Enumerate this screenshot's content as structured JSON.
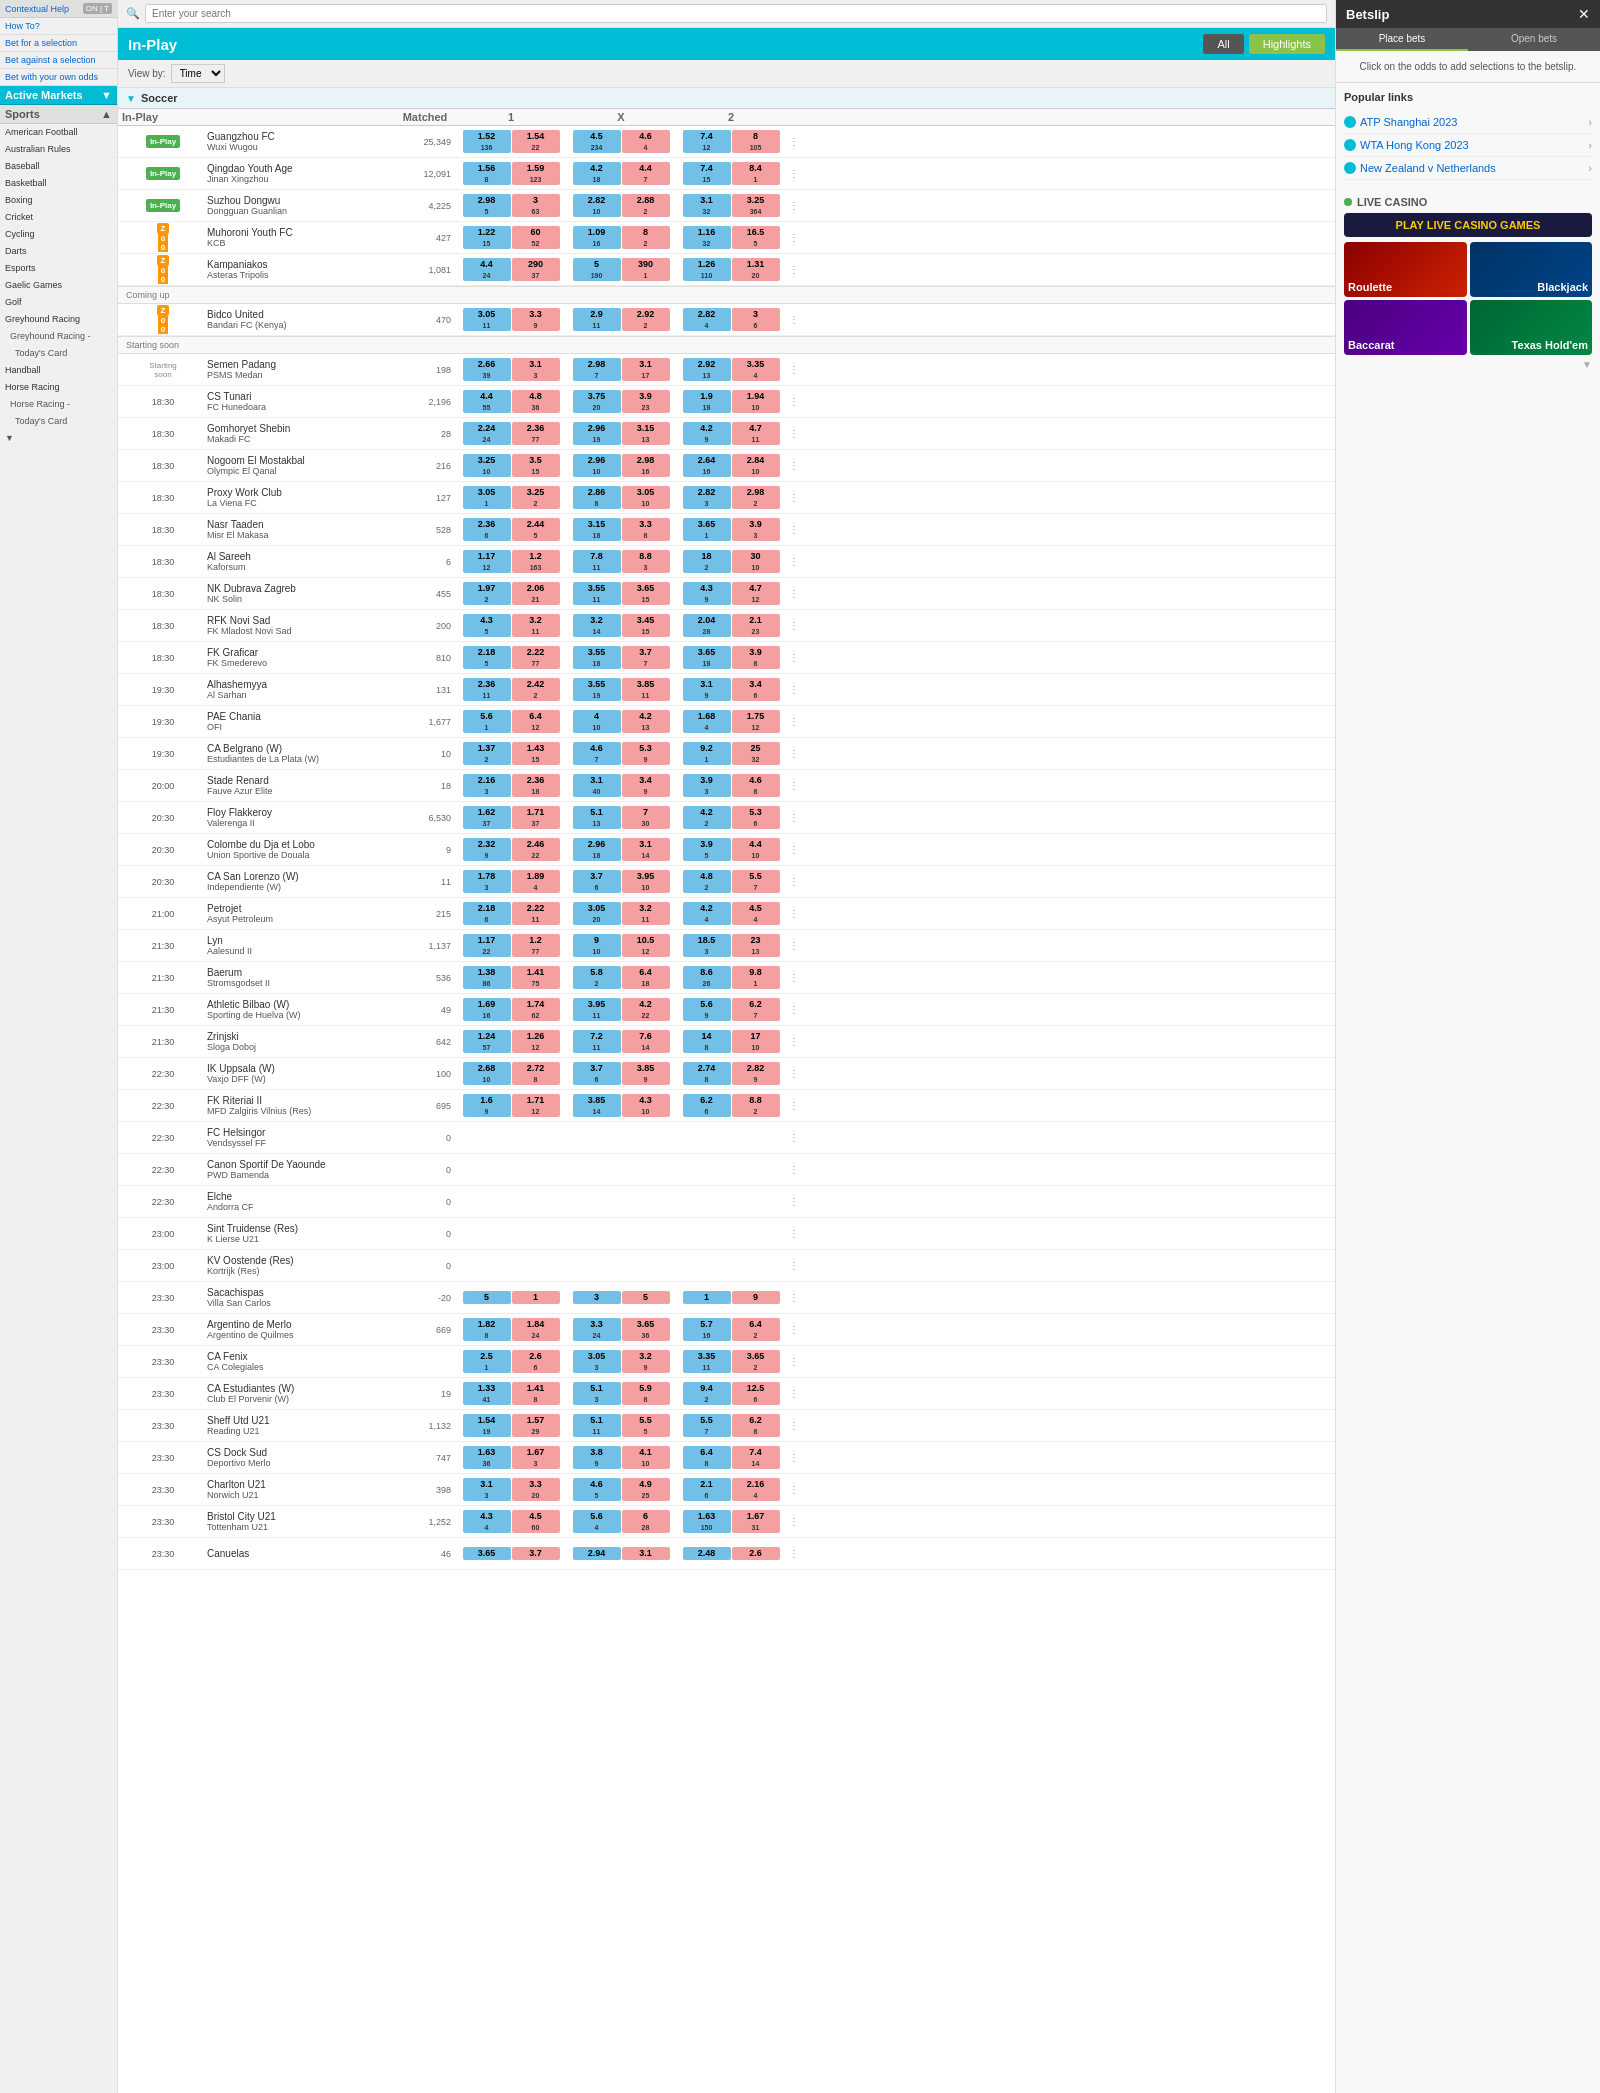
{
  "header": {
    "search_placeholder": "Enter your search",
    "in_play_title": "In-Play",
    "btn_all": "All",
    "btn_highlights": "Highlights",
    "view_by_label": "View by:",
    "view_by_value": "Time"
  },
  "topbar": {
    "contextual_help": "Contextual Help",
    "how_to": "How To?",
    "bet_for_selection": "Bet for a selection",
    "bet_against_selection": "Bet against a selection",
    "bet_own_odds": "Bet with your own odds",
    "active_markets": "Active Markets"
  },
  "sidebar": {
    "sports_label": "Sports",
    "items": [
      "American Football",
      "Australian Rules",
      "Baseball",
      "Basketball",
      "Boxing",
      "Cricket",
      "Cycling",
      "Darts",
      "Esports",
      "Gaelic Games",
      "Golf",
      "Greyhound Racing",
      "Greyhound Racing -",
      "Today's Card",
      "Handball",
      "Horse Racing",
      "Horse Racing -",
      "Today's Card"
    ]
  },
  "betslip": {
    "title": "Betslip",
    "tab_place": "Place bets",
    "tab_open": "Open bets",
    "message": "Click on the odds to add selections to the betslip.",
    "popular_links_title": "Popular links",
    "links": [
      "ATP Shanghai 2023",
      "WTA Hong Kong 2023",
      "New Zealand v Netherlands"
    ],
    "live_casino_label": "LIVE CASINO",
    "casino_banner": "PLAY LIVE CASINO GAMES",
    "games": [
      "Roulette",
      "Blackjack",
      "Baccarat",
      "Texas Hold'em"
    ]
  },
  "section": {
    "soccer_label": "Soccer",
    "col_in_play": "In-Play",
    "col_matched": "Matched",
    "col_1": "1",
    "col_x": "X",
    "col_2": "2"
  },
  "matches": [
    {
      "status": "In-Play",
      "time": "",
      "team1": "Guangzhou FC",
      "team2": "Wuxi Wugou",
      "matched": "25,349",
      "b1": "1.52",
      "b1s": "136",
      "l1": "1.54",
      "l1s": "22",
      "bx": "4.5",
      "bxs": "234",
      "lx": "4.6",
      "lxs": "4",
      "b2": "7.4",
      "b2s": "12",
      "l2": "8",
      "l2s": "105"
    },
    {
      "status": "In-Play",
      "time": "",
      "team1": "Qingdao Youth Age",
      "team2": "Jinan Xingzhou",
      "matched": "12,091",
      "b1": "1.56",
      "b1s": "8",
      "l1": "1.59",
      "l1s": "123",
      "bx": "4.2",
      "bxs": "18",
      "lx": "4.4",
      "lxs": "7",
      "b2": "7.4",
      "b2s": "15",
      "l2": "8.4",
      "l2s": "1"
    },
    {
      "status": "In-Play",
      "time": "",
      "team1": "Suzhou Dongwu",
      "team2": "Dongguan Guanlian",
      "matched": "4,225",
      "b1": "2.98",
      "b1s": "5",
      "l1": "3",
      "l1s": "63",
      "bx": "2.82",
      "bxs": "10",
      "lx": "2.88",
      "lxs": "2",
      "b2": "3.1",
      "b2s": "32",
      "l2": "3.25",
      "l2s": "364"
    },
    {
      "status": "z",
      "score1": "0",
      "score2": "0",
      "time": "",
      "team1": "Muhoroni Youth FC",
      "team2": "KCB",
      "matched": "427",
      "b1": "1.22",
      "b1s": "15",
      "l1": "60",
      "l1s": "52",
      "bx": "1.09",
      "bxs": "16",
      "lx": "8",
      "lxs": "2",
      "b2": "1.16",
      "b2s": "32",
      "l2": "16.5",
      "l2s": "5"
    },
    {
      "status": "z",
      "score1": "0",
      "score2": "0",
      "time": "",
      "team1": "Kampaniakos",
      "team2": "Asteras Tripolis",
      "matched": "1,081",
      "b1": "4.4",
      "b1s": "24",
      "l1": "290",
      "l1s": "37",
      "bx": "5",
      "bxs": "190",
      "lx": "390",
      "lxs": "1",
      "b2": "1.26",
      "b2s": "110",
      "l2": "1.31",
      "l2s": "20"
    },
    {
      "group": "Coming up",
      "status": "cu",
      "score1": "0",
      "score2": "0",
      "time": "",
      "team1": "Bidco United",
      "team2": "Bandari FC (Kenya)",
      "matched": "470",
      "b1": "3.05",
      "b1s": "11",
      "l1": "3.3",
      "l1s": "9",
      "bx": "2.9",
      "bxs": "11",
      "lx": "2.92",
      "lxs": "2",
      "b2": "2.82",
      "b2s": "4",
      "l2": "3",
      "l2s": "6"
    },
    {
      "group": "Starting soon",
      "status": "ss",
      "time": "",
      "team1": "Semen Padang",
      "team2": "PSMS Medan",
      "matched": "198",
      "b1": "2.66",
      "b1s": "39",
      "l1": "3.1",
      "l1s": "3",
      "bx": "2.98",
      "bxs": "7",
      "lx": "3.1",
      "lxs": "17",
      "b2": "2.92",
      "b2s": "13",
      "l2": "3.35",
      "l2s": "4"
    },
    {
      "status": "t1830",
      "time": "18:30",
      "team1": "CS Tunari",
      "team2": "FC Hunedoara",
      "matched": "2,196",
      "b1": "4.4",
      "b1s": "55",
      "l1": "4.8",
      "l1s": "36",
      "bx": "3.75",
      "bxs": "20",
      "lx": "3.9",
      "lxs": "23",
      "b2": "1.9",
      "b2s": "18",
      "l2": "1.94",
      "l2s": "10"
    },
    {
      "status": "t1830",
      "time": "18:30",
      "team1": "Gomhoryet Shebin",
      "team2": "Makadi FC",
      "matched": "28",
      "b1": "2.24",
      "b1s": "24",
      "l1": "2.36",
      "l1s": "77",
      "bx": "2.96",
      "bxs": "19",
      "lx": "3.15",
      "lxs": "13",
      "b2": "4.2",
      "b2s": "9",
      "l2": "4.7",
      "l2s": "11"
    },
    {
      "status": "t1830",
      "time": "18:30",
      "team1": "Nogoom El Mostakbal",
      "team2": "Olympic El Qanal",
      "matched": "216",
      "b1": "3.25",
      "b1s": "10",
      "l1": "3.5",
      "l1s": "15",
      "bx": "2.96",
      "bxs": "10",
      "lx": "2.98",
      "lxs": "16",
      "b2": "2.64",
      "b2s": "16",
      "l2": "2.84",
      "l2s": "10"
    },
    {
      "status": "t1830",
      "time": "18:30",
      "team1": "Proxy Work Club",
      "team2": "La Viena FC",
      "matched": "127",
      "b1": "3.05",
      "b1s": "1",
      "l1": "3.25",
      "l1s": "2",
      "bx": "2.86",
      "bxs": "8",
      "lx": "3.05",
      "lxs": "10",
      "b2": "2.82",
      "b2s": "3",
      "l2": "2.98",
      "l2s": "2"
    },
    {
      "status": "t1830",
      "time": "18:30",
      "team1": "Nasr Taaden",
      "team2": "Misr El Makasa",
      "matched": "528",
      "b1": "2.36",
      "b1s": "6",
      "l1": "2.44",
      "l1s": "5",
      "bx": "3.15",
      "bxs": "18",
      "lx": "3.3",
      "lxs": "8",
      "b2": "3.65",
      "b2s": "1",
      "l2": "3.9",
      "l2s": "3"
    },
    {
      "status": "t1830",
      "time": "18:30",
      "team1": "Al Sareeh",
      "team2": "Kaforsum",
      "matched": "6",
      "b1": "1.17",
      "b1s": "12",
      "l1": "1.2",
      "l1s": "163",
      "bx": "7.8",
      "bxs": "11",
      "lx": "8.8",
      "lxs": "3",
      "b2": "18",
      "b2s": "2",
      "l2": "30",
      "l2s": "10"
    },
    {
      "status": "t1830",
      "time": "18:30",
      "team1": "NK Dubrava Zagreb",
      "team2": "NK Solin",
      "matched": "455",
      "b1": "1.97",
      "b1s": "2",
      "l1": "2.06",
      "l1s": "21",
      "bx": "3.55",
      "bxs": "11",
      "lx": "3.65",
      "lxs": "15",
      "b2": "4.3",
      "b2s": "9",
      "l2": "4.7",
      "l2s": "12"
    },
    {
      "status": "t1830",
      "time": "18:30",
      "team1": "RFK Novi Sad",
      "team2": "FK Mladost Novi Sad",
      "matched": "200",
      "b1": "4.3",
      "b1s": "5",
      "l1": "3.2",
      "l1s": "11",
      "bx": "3.2",
      "bxs": "14",
      "lx": "3.45",
      "lxs": "15",
      "b2": "2.04",
      "b2s": "28",
      "l2": "2.1",
      "l2s": "23"
    },
    {
      "status": "t1830",
      "time": "18:30",
      "team1": "FK Graficar",
      "team2": "FK Smederevo",
      "matched": "810",
      "b1": "2.18",
      "b1s": "5",
      "l1": "2.22",
      "l1s": "77",
      "bx": "3.55",
      "bxs": "18",
      "lx": "3.7",
      "lxs": "7",
      "b2": "3.65",
      "b2s": "18",
      "l2": "3.9",
      "l2s": "8"
    },
    {
      "status": "t1930",
      "time": "19:30",
      "team1": "Alhashemyya",
      "team2": "Al Sarhan",
      "matched": "131",
      "b1": "2.36",
      "b1s": "11",
      "l1": "2.42",
      "l1s": "2",
      "bx": "3.55",
      "bxs": "19",
      "lx": "3.85",
      "lxs": "11",
      "b2": "3.1",
      "b2s": "9",
      "l2": "3.4",
      "l2s": "6"
    },
    {
      "status": "t1930",
      "time": "19:30",
      "team1": "PAE Chania",
      "team2": "OFI",
      "matched": "1,677",
      "b1": "5.6",
      "b1s": "1",
      "l1": "6.4",
      "l1s": "12",
      "bx": "4",
      "bxs": "10",
      "lx": "4.2",
      "lxs": "13",
      "b2": "1.68",
      "b2s": "4",
      "l2": "1.75",
      "l2s": "12"
    },
    {
      "status": "t1930",
      "time": "19:30",
      "team1": "CA Belgrano (W)",
      "team2": "Estudiantes de La Plata (W)",
      "matched": "10",
      "b1": "1.37",
      "b1s": "2",
      "l1": "1.43",
      "l1s": "15",
      "bx": "4.6",
      "bxs": "7",
      "lx": "5.3",
      "lxs": "9",
      "b2": "9.2",
      "b2s": "1",
      "l2": "25",
      "l2s": "32"
    },
    {
      "status": "t2000",
      "time": "20:00",
      "team1": "Stade Renard",
      "team2": "Fauve Azur Elite",
      "matched": "18",
      "b1": "2.16",
      "b1s": "3",
      "l1": "2.36",
      "l1s": "18",
      "bx": "3.1",
      "bxs": "40",
      "lx": "3.4",
      "lxs": "9",
      "b2": "3.9",
      "b2s": "3",
      "l2": "4.6",
      "l2s": "8"
    },
    {
      "status": "t2030",
      "time": "20:30",
      "team1": "Floy Flakkeroy",
      "team2": "Valerenga II",
      "matched": "6,530",
      "b1": "1.62",
      "b1s": "37",
      "l1": "1.71",
      "l1s": "37",
      "bx": "5.1",
      "bxs": "13",
      "lx": "7",
      "lxs": "30",
      "b2": "4.2",
      "b2s": "2",
      "l2": "5.3",
      "l2s": "6"
    },
    {
      "status": "t2030",
      "time": "20:30",
      "team1": "Colombe du Dja et Lobo",
      "team2": "Union Sportive de Douala",
      "matched": "9",
      "b1": "2.32",
      "b1s": "9",
      "l1": "2.46",
      "l1s": "22",
      "bx": "2.96",
      "bxs": "18",
      "lx": "3.1",
      "lxs": "14",
      "b2": "3.9",
      "b2s": "5",
      "l2": "4.4",
      "l2s": "10"
    },
    {
      "status": "t2030",
      "time": "20:30",
      "team1": "CA San Lorenzo (W)",
      "team2": "Independiente (W)",
      "matched": "11",
      "b1": "1.78",
      "b1s": "3",
      "l1": "1.89",
      "l1s": "4",
      "bx": "3.7",
      "bxs": "6",
      "lx": "3.95",
      "lxs": "10",
      "b2": "4.8",
      "b2s": "2",
      "l2": "5.5",
      "l2s": "7"
    },
    {
      "status": "t2100",
      "time": "21:00",
      "team1": "Petrojet",
      "team2": "Asyut Petroleum",
      "matched": "215",
      "b1": "2.18",
      "b1s": "6",
      "l1": "2.22",
      "l1s": "11",
      "bx": "3.05",
      "bxs": "20",
      "lx": "3.2",
      "lxs": "11",
      "b2": "4.2",
      "b2s": "4",
      "l2": "4.5",
      "l2s": "4"
    },
    {
      "status": "t2130",
      "time": "21:30",
      "team1": "Lyn",
      "team2": "Aalesund II",
      "matched": "1,137",
      "b1": "1.17",
      "b1s": "22",
      "l1": "1.2",
      "l1s": "77",
      "bx": "9",
      "bxs": "10",
      "lx": "10.5",
      "lxs": "12",
      "b2": "18.5",
      "b2s": "3",
      "l2": "23",
      "l2s": "13"
    },
    {
      "status": "t2130",
      "time": "21:30",
      "team1": "Baerum",
      "team2": "Stromsgodset II",
      "matched": "536",
      "b1": "1.38",
      "b1s": "86",
      "l1": "1.41",
      "l1s": "75",
      "bx": "5.8",
      "bxs": "2",
      "lx": "6.4",
      "lxs": "18",
      "b2": "8.6",
      "b2s": "26",
      "l2": "9.8",
      "l2s": "1"
    },
    {
      "status": "t2130",
      "time": "21:30",
      "team1": "Athletic Bilbao (W)",
      "team2": "Sporting de Huelva (W)",
      "matched": "49",
      "b1": "1.69",
      "b1s": "16",
      "l1": "1.74",
      "l1s": "62",
      "bx": "3.95",
      "bxs": "11",
      "lx": "4.2",
      "lxs": "22",
      "b2": "5.6",
      "b2s": "9",
      "l2": "6.2",
      "l2s": "7"
    },
    {
      "status": "t2130",
      "time": "21:30",
      "team1": "Zrinjski",
      "team2": "Sloga Doboj",
      "matched": "642",
      "b1": "1.24",
      "b1s": "57",
      "l1": "1.26",
      "l1s": "12",
      "bx": "7.2",
      "bxs": "11",
      "lx": "7.6",
      "lxs": "14",
      "b2": "14",
      "b2s": "8",
      "l2": "17",
      "l2s": "10"
    },
    {
      "status": "t2230",
      "time": "22:30",
      "team1": "IK Uppsala (W)",
      "team2": "Vaxjo DFF (W)",
      "matched": "100",
      "b1": "2.68",
      "b1s": "10",
      "l1": "2.72",
      "l1s": "8",
      "bx": "3.7",
      "bxs": "6",
      "lx": "3.85",
      "lxs": "9",
      "b2": "2.74",
      "b2s": "8",
      "l2": "2.82",
      "l2s": "9"
    },
    {
      "status": "t2230",
      "time": "22:30",
      "team1": "FK Riteriai II",
      "team2": "MFD Zalgiris Vilnius (Res)",
      "matched": "695",
      "b1": "1.6",
      "b1s": "9",
      "l1": "1.71",
      "l1s": "12",
      "bx": "3.85",
      "bxs": "14",
      "lx": "4.3",
      "lxs": "10",
      "b2": "6.2",
      "b2s": "6",
      "l2": "8.8",
      "l2s": "2"
    },
    {
      "status": "t2230",
      "time": "22:30",
      "team1": "FC Helsingor",
      "team2": "Vendsyssel FF",
      "matched": "0",
      "b1": "",
      "b1s": "",
      "l1": "",
      "l1s": "",
      "bx": "",
      "bxs": "",
      "lx": "",
      "lxs": "",
      "b2": "",
      "b2s": "",
      "l2": "",
      "l2s": ""
    },
    {
      "status": "t2230",
      "time": "22:30",
      "team1": "Canon Sportif De Yaounde",
      "team2": "PWD Bamenda",
      "matched": "0",
      "b1": "",
      "b1s": "",
      "l1": "",
      "l1s": "",
      "bx": "",
      "bxs": "",
      "lx": "",
      "lxs": "",
      "b2": "",
      "b2s": "",
      "l2": "",
      "l2s": ""
    },
    {
      "status": "t2230",
      "time": "22:30",
      "team1": "Elche",
      "team2": "Andorra CF",
      "matched": "0",
      "b1": "",
      "b1s": "",
      "l1": "",
      "l1s": "",
      "bx": "",
      "bxs": "",
      "lx": "",
      "lxs": "",
      "b2": "",
      "b2s": "",
      "l2": "",
      "l2s": ""
    },
    {
      "status": "t2300",
      "time": "23:00",
      "team1": "Sint Truidense (Res)",
      "team2": "K Lierse U21",
      "matched": "0",
      "b1": "",
      "b1s": "",
      "l1": "",
      "l1s": "",
      "bx": "",
      "bxs": "",
      "lx": "",
      "lxs": "",
      "b2": "",
      "b2s": "",
      "l2": "",
      "l2s": ""
    },
    {
      "status": "t2300",
      "time": "23:00",
      "team1": "KV Oostende (Res)",
      "team2": "Kortrijk (Res)",
      "matched": "0",
      "b1": "",
      "b1s": "",
      "l1": "",
      "l1s": "",
      "bx": "",
      "bxs": "",
      "lx": "",
      "lxs": "",
      "b2": "",
      "b2s": "",
      "l2": "",
      "l2s": ""
    },
    {
      "status": "t2330",
      "time": "23:30",
      "team1": "Sacachispas",
      "team2": "Villa San Carlos",
      "matched": "-20",
      "b1": "5",
      "b1s": "",
      "l1": "1",
      "l1s": "",
      "bx": "3",
      "bxs": "",
      "lx": "5",
      "lxs": "",
      "b2": "1",
      "b2s": "",
      "l2": "9",
      "l2s": ""
    },
    {
      "status": "t2330",
      "time": "23:30",
      "team1": "Argentino de Merlo",
      "team2": "Argentino de Quilmes",
      "matched": "669",
      "b1": "1.82",
      "b1s": "8",
      "l1": "1.84",
      "l1s": "24",
      "bx": "3.3",
      "bxs": "24",
      "lx": "3.65",
      "lxs": "36",
      "b2": "5.7",
      "b2s": "16",
      "l2": "6.4",
      "l2s": "2"
    },
    {
      "status": "t2330",
      "time": "23:30",
      "team1": "CA Fenix",
      "team2": "CA Colegiales",
      "matched": "",
      "b1": "2.5",
      "b1s": "1",
      "l1": "2.6",
      "l1s": "6",
      "bx": "3.05",
      "bxs": "3",
      "lx": "3.2",
      "lxs": "9",
      "b2": "3.35",
      "b2s": "11",
      "l2": "3.65",
      "l2s": "2"
    },
    {
      "status": "t2330",
      "time": "23:30",
      "team1": "CA Estudiantes (W)",
      "team2": "Club El Porvenir (W)",
      "matched": "19",
      "b1": "1.33",
      "b1s": "41",
      "l1": "1.41",
      "l1s": "8",
      "bx": "5.1",
      "bxs": "3",
      "lx": "5.9",
      "lxs": "8",
      "b2": "9.4",
      "b2s": "2",
      "l2": "12.5",
      "l2s": "6"
    },
    {
      "status": "t2330",
      "time": "23:30",
      "team1": "Sheff Utd U21",
      "team2": "Reading U21",
      "matched": "1,132",
      "b1": "1.54",
      "b1s": "19",
      "l1": "1.57",
      "l1s": "29",
      "bx": "5.1",
      "bxs": "11",
      "lx": "5.5",
      "lxs": "5",
      "b2": "5.5",
      "b2s": "7",
      "l2": "6.2",
      "l2s": "8"
    },
    {
      "status": "t2330",
      "time": "23:30",
      "team1": "CS Dock Sud",
      "team2": "Deportivo Merlo",
      "matched": "747",
      "b1": "1.63",
      "b1s": "36",
      "l1": "1.67",
      "l1s": "3",
      "bx": "3.8",
      "bxs": "9",
      "lx": "4.1",
      "lxs": "10",
      "b2": "6.4",
      "b2s": "8",
      "l2": "7.4",
      "l2s": "14"
    },
    {
      "status": "t2330",
      "time": "23:30",
      "team1": "Charlton U21",
      "team2": "Norwich U21",
      "matched": "398",
      "b1": "3.1",
      "b1s": "3",
      "l1": "3.3",
      "l1s": "20",
      "bx": "4.6",
      "bxs": "5",
      "lx": "4.9",
      "lxs": "25",
      "b2": "2.1",
      "b2s": "6",
      "l2": "2.16",
      "l2s": "4"
    },
    {
      "status": "t2330",
      "time": "23:30",
      "team1": "Bristol City U21",
      "team2": "Tottenham U21",
      "matched": "1,252",
      "b1": "4.3",
      "b1s": "4",
      "l1": "4.5",
      "l1s": "60",
      "bx": "5.6",
      "bxs": "4",
      "lx": "6",
      "lxs": "28",
      "b2": "1.63",
      "b2s": "150",
      "l2": "1.67",
      "l2s": "31"
    },
    {
      "status": "t2330",
      "time": "23:30",
      "team1": "Canuelas",
      "team2": "",
      "matched": "46",
      "b1": "3.65",
      "b1s": "",
      "l1": "3.7",
      "l1s": "",
      "bx": "2.94",
      "bxs": "",
      "lx": "3.1",
      "lxs": "",
      "b2": "2.48",
      "b2s": "",
      "l2": "2.6",
      "l2s": ""
    }
  ]
}
